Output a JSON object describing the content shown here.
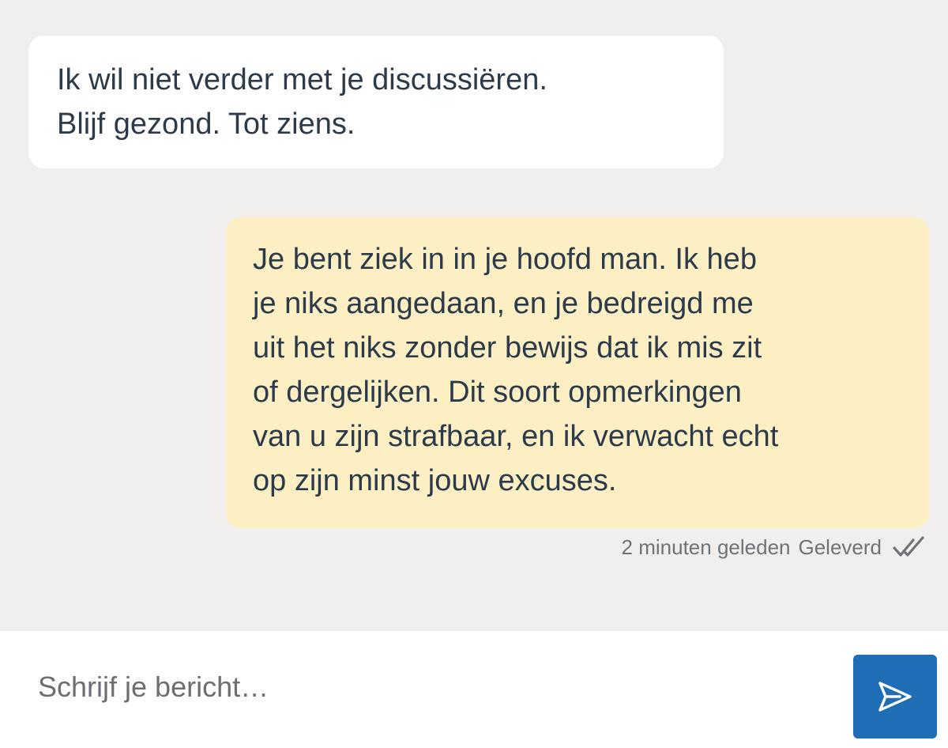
{
  "colors": {
    "background": "#f0efee",
    "incoming_bubble": "#ffffff",
    "outgoing_bubble": "#fdefc4",
    "text": "#2d3a4a",
    "meta_text": "#6f7378",
    "send_button": "#1f6db5"
  },
  "messages": [
    {
      "direction": "incoming",
      "text": "Ik wil niet verder met je discussiëren.\nBlijf gezond. Tot ziens."
    },
    {
      "direction": "outgoing",
      "text": "Je bent ziek in in je hoofd man. Ik heb\nje niks aangedaan, en je bedreigd me\nuit het niks zonder bewijs dat ik mis zit\nof dergelijken. Dit soort opmerkingen\nvan u zijn strafbaar, en ik verwacht echt\nop zijn minst jouw excuses.",
      "time": "2 minuten geleden",
      "status": "Geleverd",
      "status_icon": "double-check-icon"
    }
  ],
  "composer": {
    "placeholder": "Schrijf je bericht…",
    "value": "",
    "send_icon": "send-icon"
  }
}
